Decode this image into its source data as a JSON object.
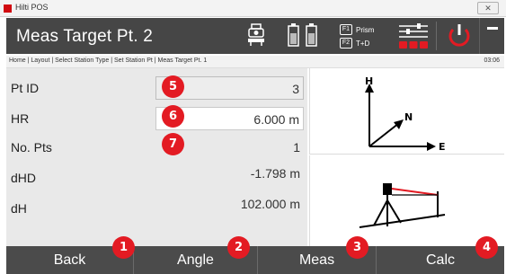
{
  "window": {
    "title": "Hilti POS",
    "close_label": "✕"
  },
  "header": {
    "screen_title": "Meas Target Pt. 2",
    "prism": {
      "f1_key": "F1",
      "f1_label": "Prism",
      "f2_key": "F2",
      "f2_label": "T+D"
    }
  },
  "breadcrumb": {
    "path": "Home | Layout | Select Station Type | Set Station Pt | Meas Target Pt. 1",
    "time": "03:06"
  },
  "rows": [
    {
      "label": "Pt ID",
      "value": "3"
    },
    {
      "label": "HR",
      "value": "6.000 m"
    },
    {
      "label": "No. Pts",
      "value": "1"
    },
    {
      "label": "dHD",
      "value": "-1.798 m"
    },
    {
      "label": "dH",
      "value": "102.000 m"
    }
  ],
  "diagram": {
    "axis_h": "H",
    "axis_n": "N",
    "axis_e": "E"
  },
  "softkeys": [
    {
      "label": "Back"
    },
    {
      "label": "Angle"
    },
    {
      "label": "Meas"
    },
    {
      "label": "Calc"
    }
  ],
  "callouts": [
    "1",
    "2",
    "3",
    "4",
    "5",
    "6",
    "7"
  ],
  "colors": {
    "accent_red": "#e31b23",
    "header_bg": "#464646",
    "softkey_bg": "#4b4b4b"
  }
}
